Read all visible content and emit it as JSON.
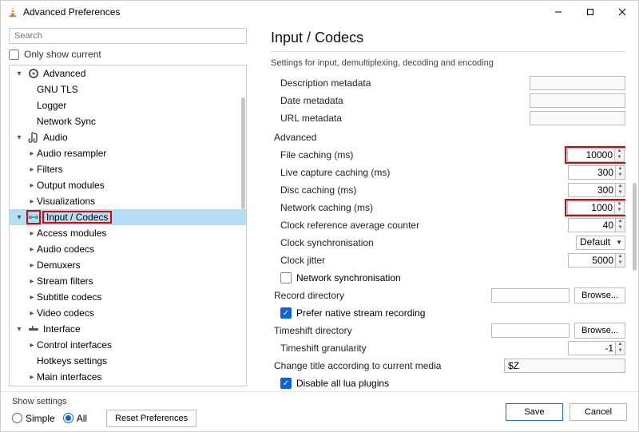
{
  "window": {
    "title": "Advanced Preferences"
  },
  "search": {
    "placeholder": "Search"
  },
  "only_show_current": "Only show current",
  "tree": {
    "advanced": "Advanced",
    "gnu_tls": "GNU TLS",
    "logger": "Logger",
    "network_sync": "Network Sync",
    "audio": "Audio",
    "audio_resampler": "Audio resampler",
    "filters": "Filters",
    "output_modules": "Output modules",
    "visualizations": "Visualizations",
    "input_codecs": "Input / Codecs",
    "access_modules": "Access modules",
    "audio_codecs": "Audio codecs",
    "demuxers": "Demuxers",
    "stream_filters": "Stream filters",
    "subtitle_codecs": "Subtitle codecs",
    "video_codecs": "Video codecs",
    "interface": "Interface",
    "control_interfaces": "Control interfaces",
    "hotkeys_settings": "Hotkeys settings",
    "main_interfaces": "Main interfaces"
  },
  "page": {
    "title": "Input / Codecs",
    "subtitle": "Settings for input, demultiplexing, decoding and encoding",
    "desc_meta": "Description metadata",
    "date_meta": "Date metadata",
    "url_meta": "URL metadata",
    "advanced_section": "Advanced",
    "file_caching": "File caching (ms)",
    "file_caching_val": "10000",
    "live_caching": "Live capture caching (ms)",
    "live_caching_val": "300",
    "disc_caching": "Disc caching (ms)",
    "disc_caching_val": "300",
    "network_caching": "Network caching (ms)",
    "network_caching_val": "1000",
    "clock_ref": "Clock reference average counter",
    "clock_ref_val": "40",
    "clock_sync": "Clock synchronisation",
    "clock_sync_val": "Default",
    "clock_jitter": "Clock jitter",
    "clock_jitter_val": "5000",
    "net_sync": "Network synchronisation",
    "record_dir": "Record directory",
    "browse": "Browse...",
    "prefer_native": "Prefer native stream recording",
    "timeshift_dir": "Timeshift directory",
    "timeshift_gran": "Timeshift granularity",
    "timeshift_gran_val": "-1",
    "change_title": "Change title according to current media",
    "change_title_val": "$Z",
    "disable_lua": "Disable all lua plugins"
  },
  "footer": {
    "show_settings": "Show settings",
    "simple": "Simple",
    "all": "All",
    "reset": "Reset Preferences",
    "save": "Save",
    "cancel": "Cancel"
  }
}
